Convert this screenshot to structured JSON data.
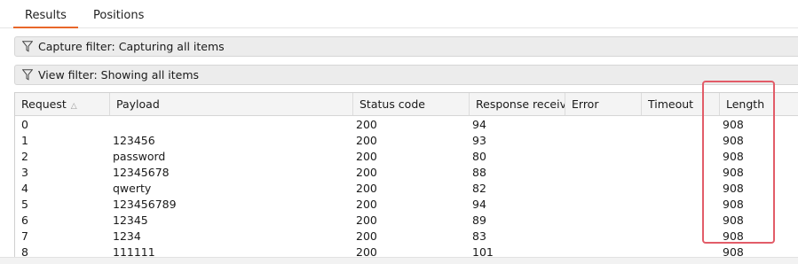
{
  "tabs": [
    {
      "label": "Results",
      "active": true
    },
    {
      "label": "Positions",
      "active": false
    }
  ],
  "filters": {
    "capture": {
      "label": "Capture filter: Capturing all items",
      "icon": "funnel-icon"
    },
    "view": {
      "label": "View filter: Showing all items",
      "icon": "funnel-icon"
    }
  },
  "table": {
    "columns": [
      "Request",
      "Payload",
      "Status code",
      "Response receiv…",
      "Error",
      "Timeout",
      "Length"
    ],
    "sort": {
      "column": "Request",
      "icon": "sort-ascending-icon"
    },
    "rows": [
      [
        "0",
        "",
        "200",
        "94",
        "",
        "",
        "908"
      ],
      [
        "1",
        "123456",
        "200",
        "93",
        "",
        "",
        "908"
      ],
      [
        "2",
        "password",
        "200",
        "80",
        "",
        "",
        "908"
      ],
      [
        "3",
        "12345678",
        "200",
        "88",
        "",
        "",
        "908"
      ],
      [
        "4",
        "qwerty",
        "200",
        "82",
        "",
        "",
        "908"
      ],
      [
        "5",
        "123456789",
        "200",
        "94",
        "",
        "",
        "908"
      ],
      [
        "6",
        "12345",
        "200",
        "89",
        "",
        "",
        "908"
      ],
      [
        "7",
        "1234",
        "200",
        "83",
        "",
        "",
        "908"
      ],
      [
        "8",
        "111111",
        "200",
        "101",
        "",
        "",
        "908"
      ]
    ]
  },
  "colors": {
    "accent": "#e8672a",
    "highlight": "#e25c68"
  }
}
